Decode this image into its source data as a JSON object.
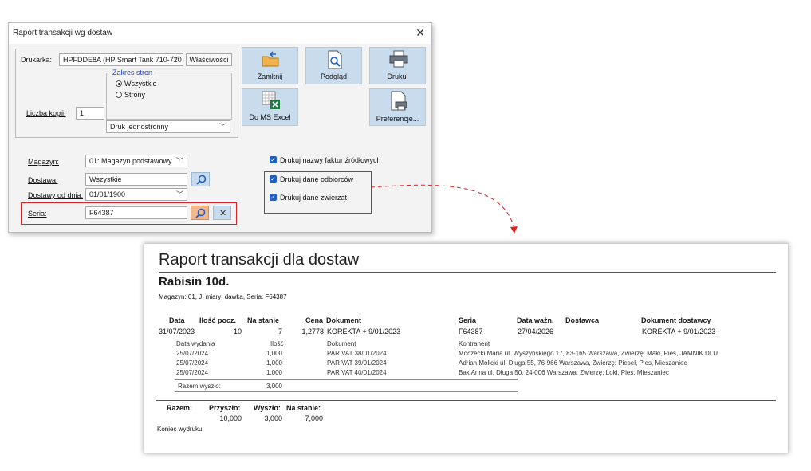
{
  "dialog": {
    "title": "Raport transakcji wg dostaw",
    "close_glyph": "✕",
    "printer_label": "Drukarka:",
    "printer_value": "HPFDDE8A (HP Smart Tank 710-720",
    "properties_button": "Właściwości",
    "page_range_legend": "Zakres stron",
    "radio_all": "Wszystkie",
    "radio_pages": "Strony",
    "copies_label": "Liczba kopii:",
    "copies_value": "1",
    "duplex_value": "Druk jednostronny",
    "buttons": {
      "close": "Zamknij",
      "preview": "Podgląd",
      "print": "Drukuj",
      "excel": "Do MS Excel",
      "preferences": "Preferencje..."
    },
    "warehouse_label": "Magazyn:",
    "warehouse_value": "01: Magazyn podstawowy",
    "delivery_label": "Dostawa:",
    "delivery_value": "Wszystkie",
    "date_label": "Dostawy od dnia:",
    "date_value": "01/01/1900",
    "series_label": "Seria:",
    "series_value": "F64387",
    "checkboxes": [
      "Drukuj nazwy faktur źródłowych",
      "Drukuj dane odbiorców",
      "Drukuj dane zwierząt"
    ],
    "clear_glyph": "✕"
  },
  "report": {
    "title": "Raport transakcji dla dostaw",
    "subtitle": "Rabisin 10d.",
    "meta": "Magazyn: 01, J. miary: dawka, Seria: F64387",
    "headers": {
      "data": "Data",
      "ilosc_pocz": "Ilość pocz.",
      "na_stanie": "Na stanie",
      "cena": "Cena",
      "dokument": "Dokument",
      "seria": "Seria",
      "data_wazn": "Data ważn.",
      "dostawca": "Dostawca",
      "dokument_dostawcy": "Dokument dostawcy"
    },
    "main_row": {
      "data": "31/07/2023",
      "ilosc_pocz": "10",
      "na_stanie": "7",
      "cena": "1,2778",
      "dokument": "KOREKTA + 9/01/2023",
      "seria": "F64387",
      "data_wazn": "27/04/2026",
      "dokument_dostawcy": "KOREKTA + 9/01/2023"
    },
    "sub_headers": {
      "data_wydania": "Data wydania",
      "ilosc": "Ilość",
      "dokument": "Dokument",
      "kontrahent": "Kontrahent"
    },
    "sub_rows": [
      {
        "date": "25/07/2024",
        "qty": "1,000",
        "doc": "PAR VAT 38/01/2024",
        "contractor": "Moczecki Maria ul. Wyszyńskiego 17, 83-165 Warszawa, Zwierzę: Maki, Pies, JAMNIK DLU"
      },
      {
        "date": "25/07/2024",
        "qty": "1,000",
        "doc": "PAR VAT 39/01/2024",
        "contractor": "Adrian Molicki ul. Długa 55, 76-966 Warszawa, Zwierzę: Pieseł, Pies, Mieszaniec"
      },
      {
        "date": "25/07/2024",
        "qty": "1,000",
        "doc": "PAR VAT 40/01/2024",
        "contractor": "Bak Anna ul. Długa 50, 24-006 Warszawa, Zwierzę: Loki, Pies, Mieszaniec"
      }
    ],
    "razem_wyszlo_label": "Razem wyszło:",
    "razem_wyszlo_value": "3,000",
    "totals": {
      "razem": "Razem:",
      "przyszlo_label": "Przyszło:",
      "wyszlo_label": "Wyszło:",
      "na_stanie_label": "Na stanie:",
      "przyszlo": "10,000",
      "wyszlo": "3,000",
      "na_stanie": "7,000"
    },
    "end_text": "Koniec wydruku."
  },
  "colors": {
    "tile": "#c9dcee",
    "highlight": "#e02020",
    "checkbox": "#1f5fbf",
    "legend": "#1f3fbf"
  },
  "icons": [
    "folder-icon",
    "preview-icon",
    "printer-icon",
    "excel-icon",
    "preferences-icon",
    "search-icon",
    "close-icon",
    "chevron-down-icon"
  ]
}
